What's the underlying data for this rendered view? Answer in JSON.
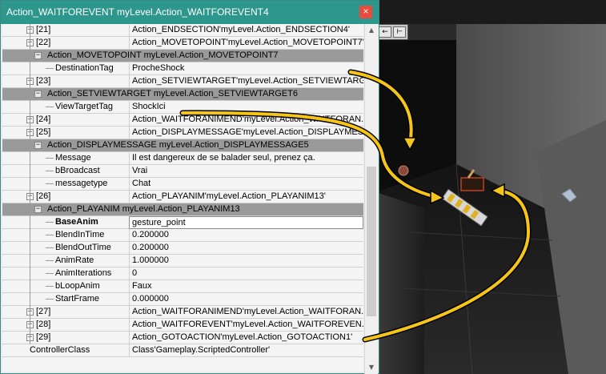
{
  "window": {
    "title": "Action_WAITFOREVENT myLevel.Action_WAITFOREVENT4",
    "close_label": "×"
  },
  "viewport_toolbar": {
    "buttons": [
      "←",
      "⊢"
    ]
  },
  "rows": [
    {
      "name": "[21]",
      "value": "Action_ENDSECTION'myLevel.Action_ENDSECTION4'",
      "kind": "item",
      "indent": 1
    },
    {
      "name": "[22]",
      "value": "Action_MOVETOPOINT'myLevel.Action_MOVETOPOINT7'",
      "kind": "item",
      "indent": 1
    },
    {
      "name": "Action_MOVETOPOINT myLevel.Action_MOVETOPOINT7",
      "value": "",
      "kind": "section",
      "indent": 2
    },
    {
      "name": "DestinationTag",
      "value": "ProcheShock",
      "kind": "prop",
      "indent": 3
    },
    {
      "name": "[23]",
      "value": "Action_SETVIEWTARGET'myLevel.Action_SETVIEWTARG...",
      "kind": "item",
      "indent": 1
    },
    {
      "name": "Action_SETVIEWTARGET myLevel.Action_SETVIEWTARGET6",
      "value": "",
      "kind": "section",
      "indent": 2
    },
    {
      "name": "ViewTargetTag",
      "value": "ShockIci",
      "kind": "prop",
      "indent": 3
    },
    {
      "name": "[24]",
      "value": "Action_WAITFORANIMEND'myLevel.Action_WAITFORAN...",
      "kind": "item",
      "indent": 1
    },
    {
      "name": "[25]",
      "value": "Action_DISPLAYMESSAGE'myLevel.Action_DISPLAYMES...",
      "kind": "item",
      "indent": 1
    },
    {
      "name": "Action_DISPLAYMESSAGE myLevel.Action_DISPLAYMESSAGE5",
      "value": "",
      "kind": "section",
      "indent": 2
    },
    {
      "name": "Message",
      "value": "Il est dangereux de se balader seul, prenez ça.",
      "kind": "prop",
      "indent": 3
    },
    {
      "name": "bBroadcast",
      "value": "Vrai",
      "kind": "prop",
      "indent": 3
    },
    {
      "name": "messagetype",
      "value": "Chat",
      "kind": "prop",
      "indent": 3
    },
    {
      "name": "[26]",
      "value": "Action_PLAYANIM'myLevel.Action_PLAYANIM13'",
      "kind": "item",
      "indent": 1
    },
    {
      "name": "Action_PLAYANIM myLevel.Action_PLAYANIM13",
      "value": "",
      "kind": "section",
      "indent": 2
    },
    {
      "name": "BaseAnim",
      "value": "gesture_point",
      "kind": "selected",
      "indent": 3
    },
    {
      "name": "BlendInTime",
      "value": "0.200000",
      "kind": "prop",
      "indent": 3
    },
    {
      "name": "BlendOutTime",
      "value": "0.200000",
      "kind": "prop",
      "indent": 3
    },
    {
      "name": "AnimRate",
      "value": "1.000000",
      "kind": "prop",
      "indent": 3
    },
    {
      "name": "AnimIterations",
      "value": "0",
      "kind": "prop",
      "indent": 3
    },
    {
      "name": "bLoopAnim",
      "value": "Faux",
      "kind": "prop",
      "indent": 3
    },
    {
      "name": "StartFrame",
      "value": "0.000000",
      "kind": "prop",
      "indent": 3
    },
    {
      "name": "[27]",
      "value": "Action_WAITFORANIMEND'myLevel.Action_WAITFORAN...",
      "kind": "item",
      "indent": 1
    },
    {
      "name": "[28]",
      "value": "Action_WAITFOREVENT'myLevel.Action_WAITFOREVEN...",
      "kind": "item",
      "indent": 1
    },
    {
      "name": "[29]",
      "value": "Action_GOTOACTION'myLevel.Action_GOTOACTION1'",
      "kind": "item",
      "indent": 1
    },
    {
      "name": "ControllerClass",
      "value": "Class'Gameplay.ScriptedController'",
      "kind": "root",
      "indent": 0
    }
  ],
  "colors": {
    "titlebar": "#2e978d",
    "section": "#9a9a9a",
    "arrow": "#f5c518"
  }
}
